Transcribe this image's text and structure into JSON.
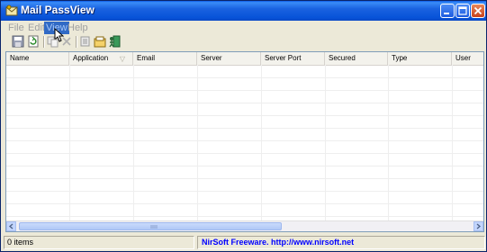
{
  "window": {
    "title": "Mail PassView"
  },
  "menu": [
    {
      "label": "File",
      "active": false
    },
    {
      "label": "Edit",
      "active": false
    },
    {
      "label": "View",
      "active": true
    },
    {
      "label": "Help",
      "active": false
    }
  ],
  "toolbar_icons": [
    "save-icon",
    "refresh-icon",
    "copy-icon",
    "delete-icon",
    "select-all-icon",
    "properties-icon",
    "exit-icon"
  ],
  "columns": [
    "Name",
    "Application",
    "Email",
    "Server",
    "Server Port",
    "Secured",
    "Type",
    "User"
  ],
  "sort_column": "Application",
  "status": {
    "count": "0 items",
    "brand": "NirSoft Freeware.  http://www.nirsoft.net"
  },
  "colors": {
    "titlebar": "#0753d8",
    "accent": "#316ac5",
    "window": "#ece9d8"
  }
}
